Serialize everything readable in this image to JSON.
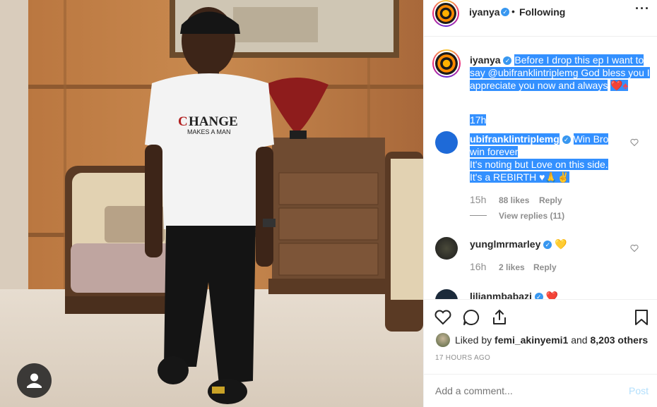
{
  "post": {
    "author": "iyanya",
    "following_label": "Following",
    "dot_sep": "•",
    "more_icon": "more-dots-icon"
  },
  "caption": {
    "username": "iyanya",
    "text": "Before I drop this ep I want to say @ubifranklintriplemg God bless you I appreciate you now and always",
    "emojis": "❤️♠",
    "time": "17h"
  },
  "comments": [
    {
      "username": "ubifranklintriplemg",
      "text_line1": "Win Bro",
      "text_line2": "win forever",
      "text_line3": "It's noting but Love on this side.",
      "text_line4": "It's a REBIRTH ♥🙏✌",
      "time": "15h",
      "likes": "88 likes",
      "reply": "Reply",
      "view_replies": "View replies (11)"
    },
    {
      "username": "yunglmrmarley",
      "emoji": "💛",
      "time": "16h",
      "likes": "2 likes",
      "reply": "Reply"
    },
    {
      "username": "lilianmbabazi",
      "emoji": "❤️"
    }
  ],
  "likes_line": {
    "prefix": "Liked by",
    "user": "femi_akinyemi1",
    "and": "and",
    "others": "8,203 others"
  },
  "timestamp": "17 HOURS AGO",
  "add_comment": {
    "placeholder": "Add a comment...",
    "post_label": "Post"
  },
  "colors": {
    "verified": "#3897f0",
    "selection": "#3390ff",
    "link": "#3897f0",
    "heart": "#ed4956"
  }
}
